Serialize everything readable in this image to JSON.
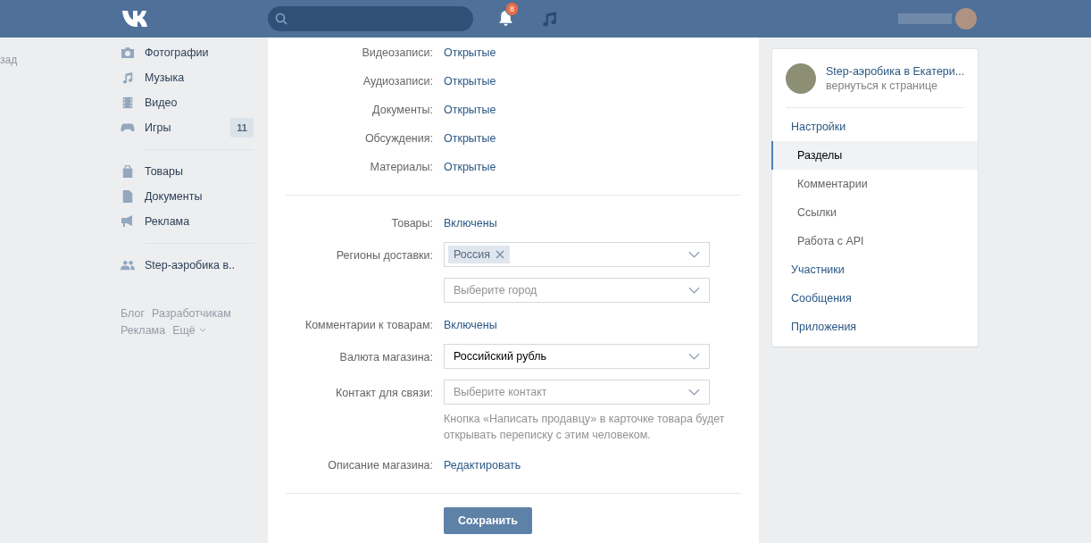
{
  "header": {
    "notifications_badge": "8"
  },
  "back_link": "зад",
  "left_menu": {
    "groups": [
      {
        "items": [
          {
            "kind": "camera",
            "label": "Фотографии"
          },
          {
            "kind": "music",
            "label": "Музыка"
          },
          {
            "kind": "film",
            "label": "Видео"
          },
          {
            "kind": "gamepad",
            "label": "Игры",
            "count": "11"
          }
        ]
      },
      {
        "items": [
          {
            "kind": "bag",
            "label": "Товары"
          },
          {
            "kind": "document",
            "label": "Документы"
          },
          {
            "kind": "megaphone",
            "label": "Реклама"
          }
        ]
      },
      {
        "items": [
          {
            "kind": "people",
            "label": "Step-аэробика в.."
          }
        ]
      }
    ],
    "footer_links": [
      [
        "Блог",
        "Разработчикам"
      ],
      [
        "Реклама",
        "Ещё"
      ]
    ]
  },
  "sections": [
    {
      "label": "Видеозаписи:",
      "value": "Открытые"
    },
    {
      "label": "Аудиозаписи:",
      "value": "Открытые"
    },
    {
      "label": "Документы:",
      "value": "Открытые"
    },
    {
      "label": "Обсуждения:",
      "value": "Открытые"
    },
    {
      "label": "Материалы:",
      "value": "Открытые"
    }
  ],
  "shop": [
    {
      "kind": "value",
      "label": "Товары:",
      "value": "Включены"
    },
    {
      "kind": "tags",
      "label": "Регионы доставки:",
      "tags": [
        "Россия"
      ]
    },
    {
      "kind": "select",
      "placeholder": "Выберите город"
    },
    {
      "kind": "value",
      "label": "Комментарии к товарам:",
      "value": "Включены"
    },
    {
      "kind": "select",
      "label": "Валюта магазина:",
      "value": "Российский рубль"
    },
    {
      "kind": "select",
      "label": "Контакт для связи:",
      "placeholder": "Выберите контакт",
      "hint": "Кнопка «Написать продавцу» в карточке товара будет открывать переписку с этим человеком."
    },
    {
      "kind": "value",
      "label": "Описание магазина:",
      "value": "Редактировать"
    }
  ],
  "save_button": "Сохранить",
  "right_panel": {
    "group_name": "Step-аэробика в Екатери...",
    "back": "вернуться к странице",
    "nav": [
      {
        "label": "Настройки",
        "selected": false,
        "children": [
          {
            "label": "Разделы",
            "selected": true
          },
          {
            "label": "Комментарии",
            "selected": false
          },
          {
            "label": "Ссылки",
            "selected": false
          },
          {
            "label": "Работа с API",
            "selected": false
          }
        ]
      },
      {
        "label": "Участники",
        "selected": false
      },
      {
        "label": "Сообщения",
        "selected": false
      },
      {
        "label": "Приложения",
        "selected": false
      }
    ]
  }
}
